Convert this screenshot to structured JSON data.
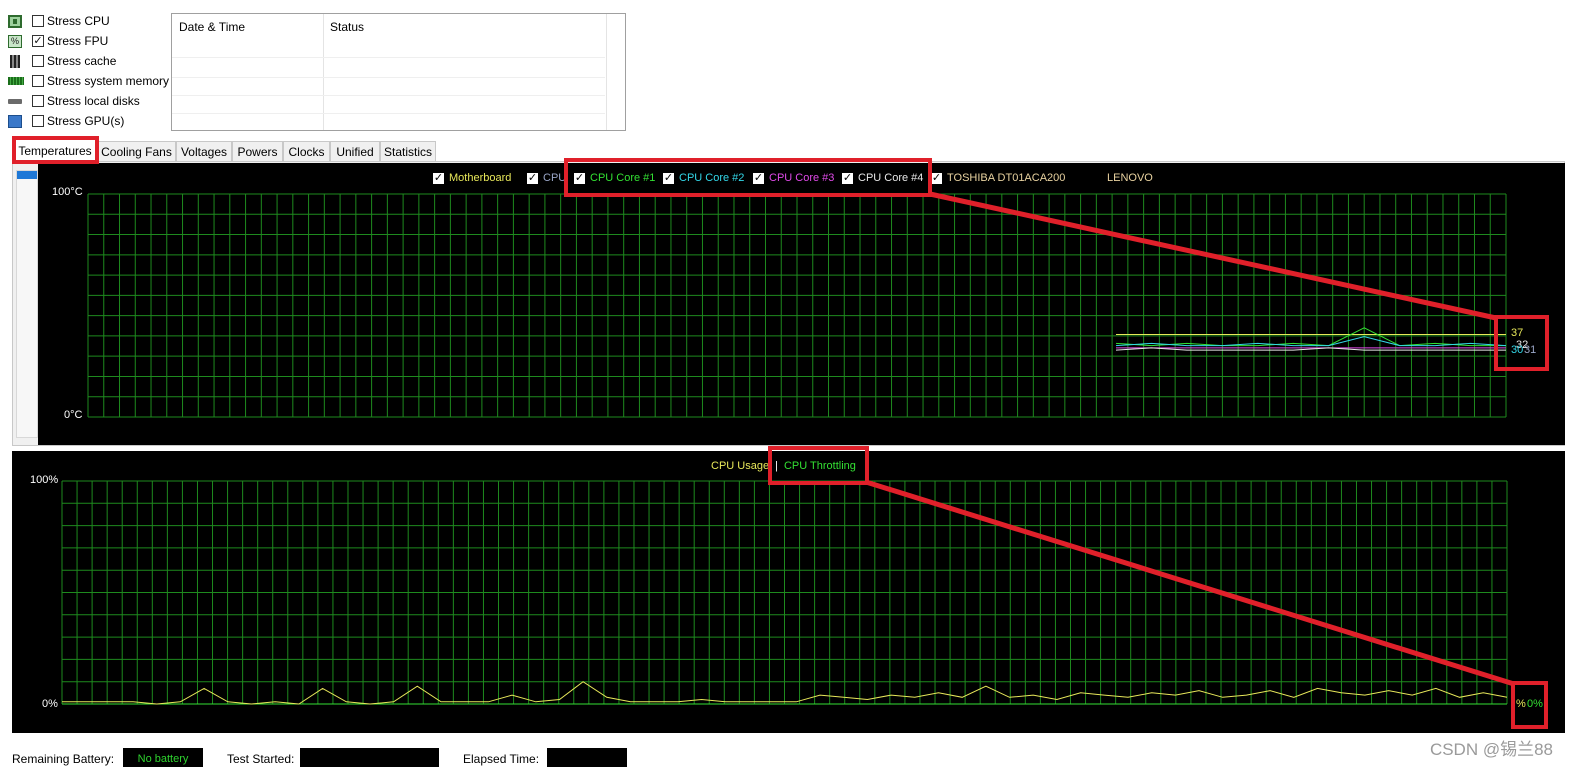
{
  "stress_options": [
    {
      "label": "Stress CPU",
      "checked": false,
      "icon": "cpu-icon"
    },
    {
      "label": "Stress FPU",
      "checked": true,
      "icon": "fpu-icon"
    },
    {
      "label": "Stress cache",
      "checked": false,
      "icon": "cache-icon"
    },
    {
      "label": "Stress system memory",
      "checked": false,
      "icon": "memory-icon"
    },
    {
      "label": "Stress local disks",
      "checked": false,
      "icon": "disk-icon"
    },
    {
      "label": "Stress GPU(s)",
      "checked": false,
      "icon": "gpu-icon"
    }
  ],
  "status_table": {
    "columns": [
      "Date & Time",
      "Status"
    ],
    "rows": []
  },
  "tabs": [
    "Temperatures",
    "Cooling Fans",
    "Voltages",
    "Powers",
    "Clocks",
    "Unified",
    "Statistics"
  ],
  "active_tab": "Temperatures",
  "temperature_graph": {
    "legend": [
      {
        "label": "Motherboard",
        "checked": true,
        "color": "#e8e85a"
      },
      {
        "label": "CPU",
        "checked": true,
        "color": "#9aa6c8"
      },
      {
        "label": "CPU Core #1",
        "checked": true,
        "color": "#33e033"
      },
      {
        "label": "CPU Core #2",
        "checked": true,
        "color": "#33d7e8"
      },
      {
        "label": "CPU Core #3",
        "checked": true,
        "color": "#e04ae8"
      },
      {
        "label": "CPU Core #4",
        "checked": true,
        "color": "#e8e8e8"
      },
      {
        "label": "TOSHIBA DT01ACA200",
        "checked": true,
        "color": "#e8d2a0"
      },
      {
        "label": "LENOVO",
        "checked": false,
        "color": "#e8d2a0"
      }
    ],
    "y_max_label": "100°C",
    "y_min_label": "0°C",
    "current_values": [
      "37",
      "32",
      "30",
      "31"
    ]
  },
  "usage_graph": {
    "legend_usage": "CPU Usage",
    "separator": "|",
    "legend_throttling": "CPU Throttling",
    "usage_color": "#e8e85a",
    "throttling_color": "#33e033",
    "y_max_label": "100%",
    "y_min_label": "0%",
    "current_usage": "%",
    "current_throttling": "0%"
  },
  "footer": {
    "remaining_battery_label": "Remaining Battery:",
    "remaining_battery_value": "No battery",
    "test_started_label": "Test Started:",
    "test_started_value": "",
    "elapsed_time_label": "Elapsed Time:",
    "elapsed_time_value": ""
  },
  "watermark": "CSDN @锡兰88",
  "chart_data": [
    {
      "type": "line",
      "ylim": [
        0,
        100
      ],
      "grid": true,
      "series": [
        {
          "name": "Motherboard",
          "values": [
            37,
            37,
            37,
            37,
            37,
            37,
            37,
            37,
            37,
            37,
            37,
            37
          ]
        },
        {
          "name": "CPU Core #1",
          "values": [
            33,
            32,
            33,
            32,
            32,
            33,
            32,
            40,
            32,
            33,
            32,
            32
          ]
        },
        {
          "name": "CPU Core #2",
          "values": [
            32,
            33,
            32,
            32,
            33,
            32,
            32,
            36,
            32,
            32,
            33,
            32
          ]
        },
        {
          "name": "CPU Core #3",
          "values": [
            31,
            31,
            31,
            31,
            31,
            31,
            31,
            31,
            31,
            31,
            31,
            31
          ]
        },
        {
          "name": "CPU Core #4",
          "values": [
            30,
            31,
            30,
            30,
            30,
            30,
            31,
            30,
            30,
            30,
            30,
            30
          ]
        }
      ]
    },
    {
      "type": "line",
      "ylim": [
        0,
        100
      ],
      "grid": true,
      "series": [
        {
          "name": "CPU Usage",
          "values": [
            1,
            1,
            1,
            1,
            0,
            1,
            7,
            1,
            0,
            1,
            0,
            7,
            1,
            0,
            1,
            8,
            1,
            1,
            1,
            4,
            1,
            2,
            10,
            3,
            1,
            1,
            1,
            2,
            1,
            1,
            1,
            1,
            4,
            3,
            2,
            4,
            3,
            5,
            3,
            8,
            3,
            4,
            2,
            5,
            4,
            3,
            5,
            4,
            6,
            3,
            4,
            6,
            3,
            7,
            5,
            4,
            6,
            4,
            7,
            3,
            5,
            3
          ]
        },
        {
          "name": "CPU Throttling",
          "values": [
            0,
            0,
            0,
            0,
            0,
            0,
            0,
            0,
            0,
            0,
            0,
            0,
            0,
            0,
            0,
            0,
            0,
            0,
            0,
            0,
            0,
            0,
            0,
            0,
            0,
            0,
            0,
            0,
            0,
            0,
            0,
            0,
            0,
            0,
            0,
            0,
            0,
            0,
            0,
            0,
            0,
            0,
            0,
            0,
            0,
            0,
            0,
            0,
            0,
            0,
            0,
            0,
            0,
            0,
            0,
            0,
            0,
            0,
            0,
            0,
            0,
            0
          ]
        }
      ]
    }
  ]
}
